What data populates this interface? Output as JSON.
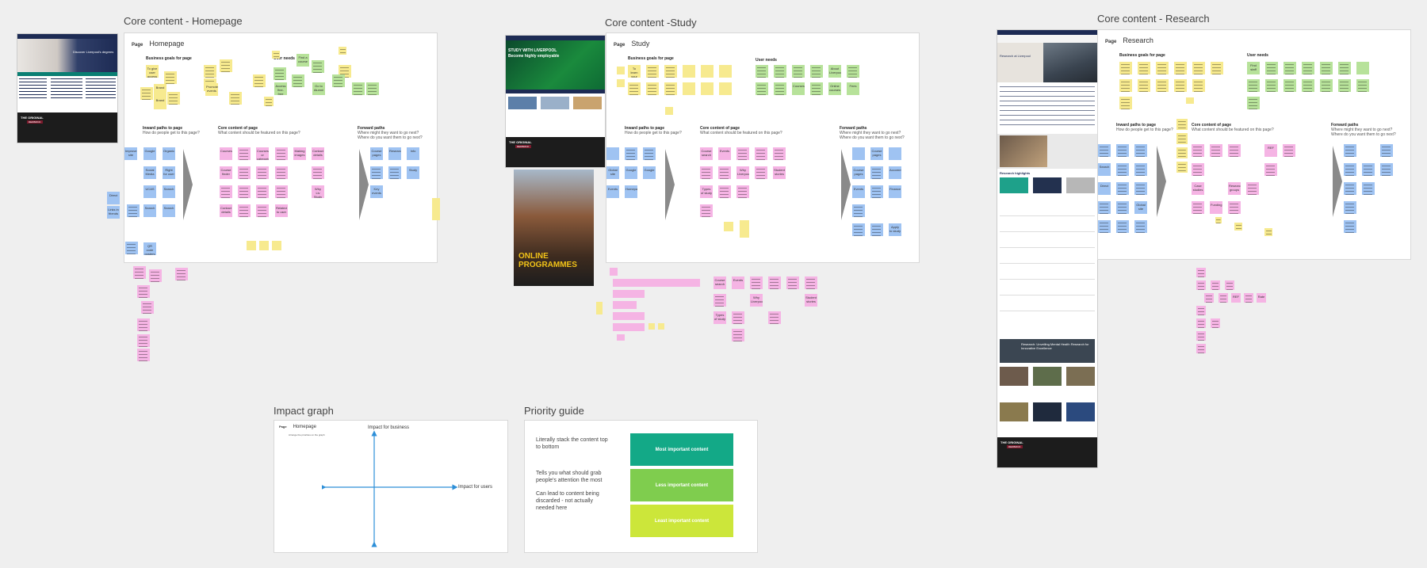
{
  "frames": {
    "homepage": {
      "title": "Core content - Homepage",
      "page_label": "Page",
      "page_name": "Homepage",
      "business_goals": "Business goals for page",
      "user_needs": "User needs",
      "inward_title": "Inward paths to page",
      "inward_sub": "How do people get to this page?",
      "core_title": "Core content of page",
      "core_sub": "What content should be featured on this page?",
      "forward_title": "Forward paths",
      "forward_sub1": "Where might they want to go next?",
      "forward_sub2": "Where do you want them to go next?",
      "notes": {
        "yellow": [
          "To give user access",
          "Brand",
          "Brand",
          "Promote events"
        ],
        "green": [
          "Find a course",
          "Access fine-free funding",
          "Go to Alumni"
        ],
        "blue_inward": [
          "Improve site",
          "Google",
          "Organic",
          "Social Media",
          "Right for user",
          "UCAS",
          "Search",
          "Search",
          "Search",
          "QR code posters"
        ],
        "pink_core": [
          "Courses",
          "Course finder",
          "Courses or categories",
          "Course stories",
          "Contact details",
          "Related to user",
          "Making images",
          "Contact details",
          "Why Liv Study"
        ],
        "blue_forward": [
          "Course pages",
          "Research",
          "Info",
          "Study",
          "Key events"
        ],
        "blue_side": [
          "Direct",
          "Links in friends"
        ]
      }
    },
    "study": {
      "title": "Core content -Study",
      "page_label": "Page",
      "page_name": "Study",
      "business_goals": "Business goals for page",
      "user_needs": "User needs",
      "inward_title": "Inward paths to page",
      "inward_sub": "How do people get to this page?",
      "core_title": "Core content of page",
      "core_sub": "What content should be featured on this page?",
      "forward_title": "Forward paths",
      "forward_sub1": "Where might they want to go next?",
      "forward_sub2": "Where do you want them to go next?",
      "notes": {
        "yellow": [
          "To learn your"
        ],
        "green": [
          "About Liverpool",
          "Courses",
          "Online courses",
          "Fees"
        ],
        "blue_inward": [
          "Global site",
          "Google",
          "Google",
          "Events",
          "Homepage"
        ],
        "pink_core": [
          "Course search",
          "Events",
          "Why Liverpool",
          "Types of study",
          "Course search",
          "Events",
          "Why Liverpool",
          "Types of study",
          "Student stories"
        ],
        "blue_forward": [
          "Course pages",
          "Course pages",
          "Events",
          "Apply to study",
          "Accommodation",
          "Finance"
        ]
      },
      "shot_headline": "STUDY WITH LIVERPOOL",
      "shot_headline2": "Become highly employable",
      "shot_banner_label": "THE ORIGINAL",
      "shot_banner_label2": "REDBRICK",
      "poster_text": "ONLINE PROGRAMMES"
    },
    "research": {
      "title": "Core content - Research",
      "page_label": "Page",
      "page_name": "Research",
      "business_goals": "Business goals for page",
      "user_needs": "User needs",
      "inward_title": "Inward paths to page",
      "inward_sub": "How do people get to this page?",
      "core_title": "Core content of page",
      "core_sub": "What content should be featured on this page?",
      "forward_title": "Forward paths",
      "forward_sub1": "Where might they want to go next?",
      "forward_sub2": "Where do you want them to go next?",
      "notes": {
        "green": [
          "Find staff"
        ],
        "blue_inward": [
          "Search",
          "Direct",
          "Global site"
        ],
        "pink_core": [
          "REF",
          "Case studies",
          "Research groups",
          "Funding"
        ],
        "pink_extra": [
          "REF",
          "Rate"
        ]
      },
      "shot_title": "Research at Liverpool",
      "shot_news": "Research highlights",
      "shot_feature": "Research: Unveiling Mental Health Research for Innovative Excellence",
      "shot_banner_label": "THE ORIGINAL",
      "shot_banner_label2": "REDBRICK"
    },
    "homepage_shot": {
      "headline": "Discover Liverpool's degrees",
      "banner_label": "THE ORIGINAL",
      "banner_label2": "REDBRICK"
    }
  },
  "impact_graph": {
    "title": "Impact graph",
    "page_label": "Page",
    "page_name": "Homepage",
    "page_sub": "Arrange the priorities on the graph",
    "y_label": "Impact for business",
    "x_label": "Impact for users"
  },
  "priority_guide": {
    "title": "Priority guide",
    "texts": [
      "Literally stack the content top to bottom",
      "Tells you what should grab people's attention the most",
      "Can lead to content being discarded - not actually needed here"
    ],
    "boxes": [
      {
        "label": "Most important content",
        "color": "#13a987"
      },
      {
        "label": "Less important content",
        "color": "#7fcd4e"
      },
      {
        "label": "Least important content",
        "color": "#cce63a"
      }
    ]
  },
  "colors": {
    "yellow_note": "#f7ea8f",
    "green_note": "#b7e29a",
    "blue_note": "#9fc3f2",
    "pink_note": "#f5b4e4",
    "axis_blue": "#2d8fd8"
  }
}
